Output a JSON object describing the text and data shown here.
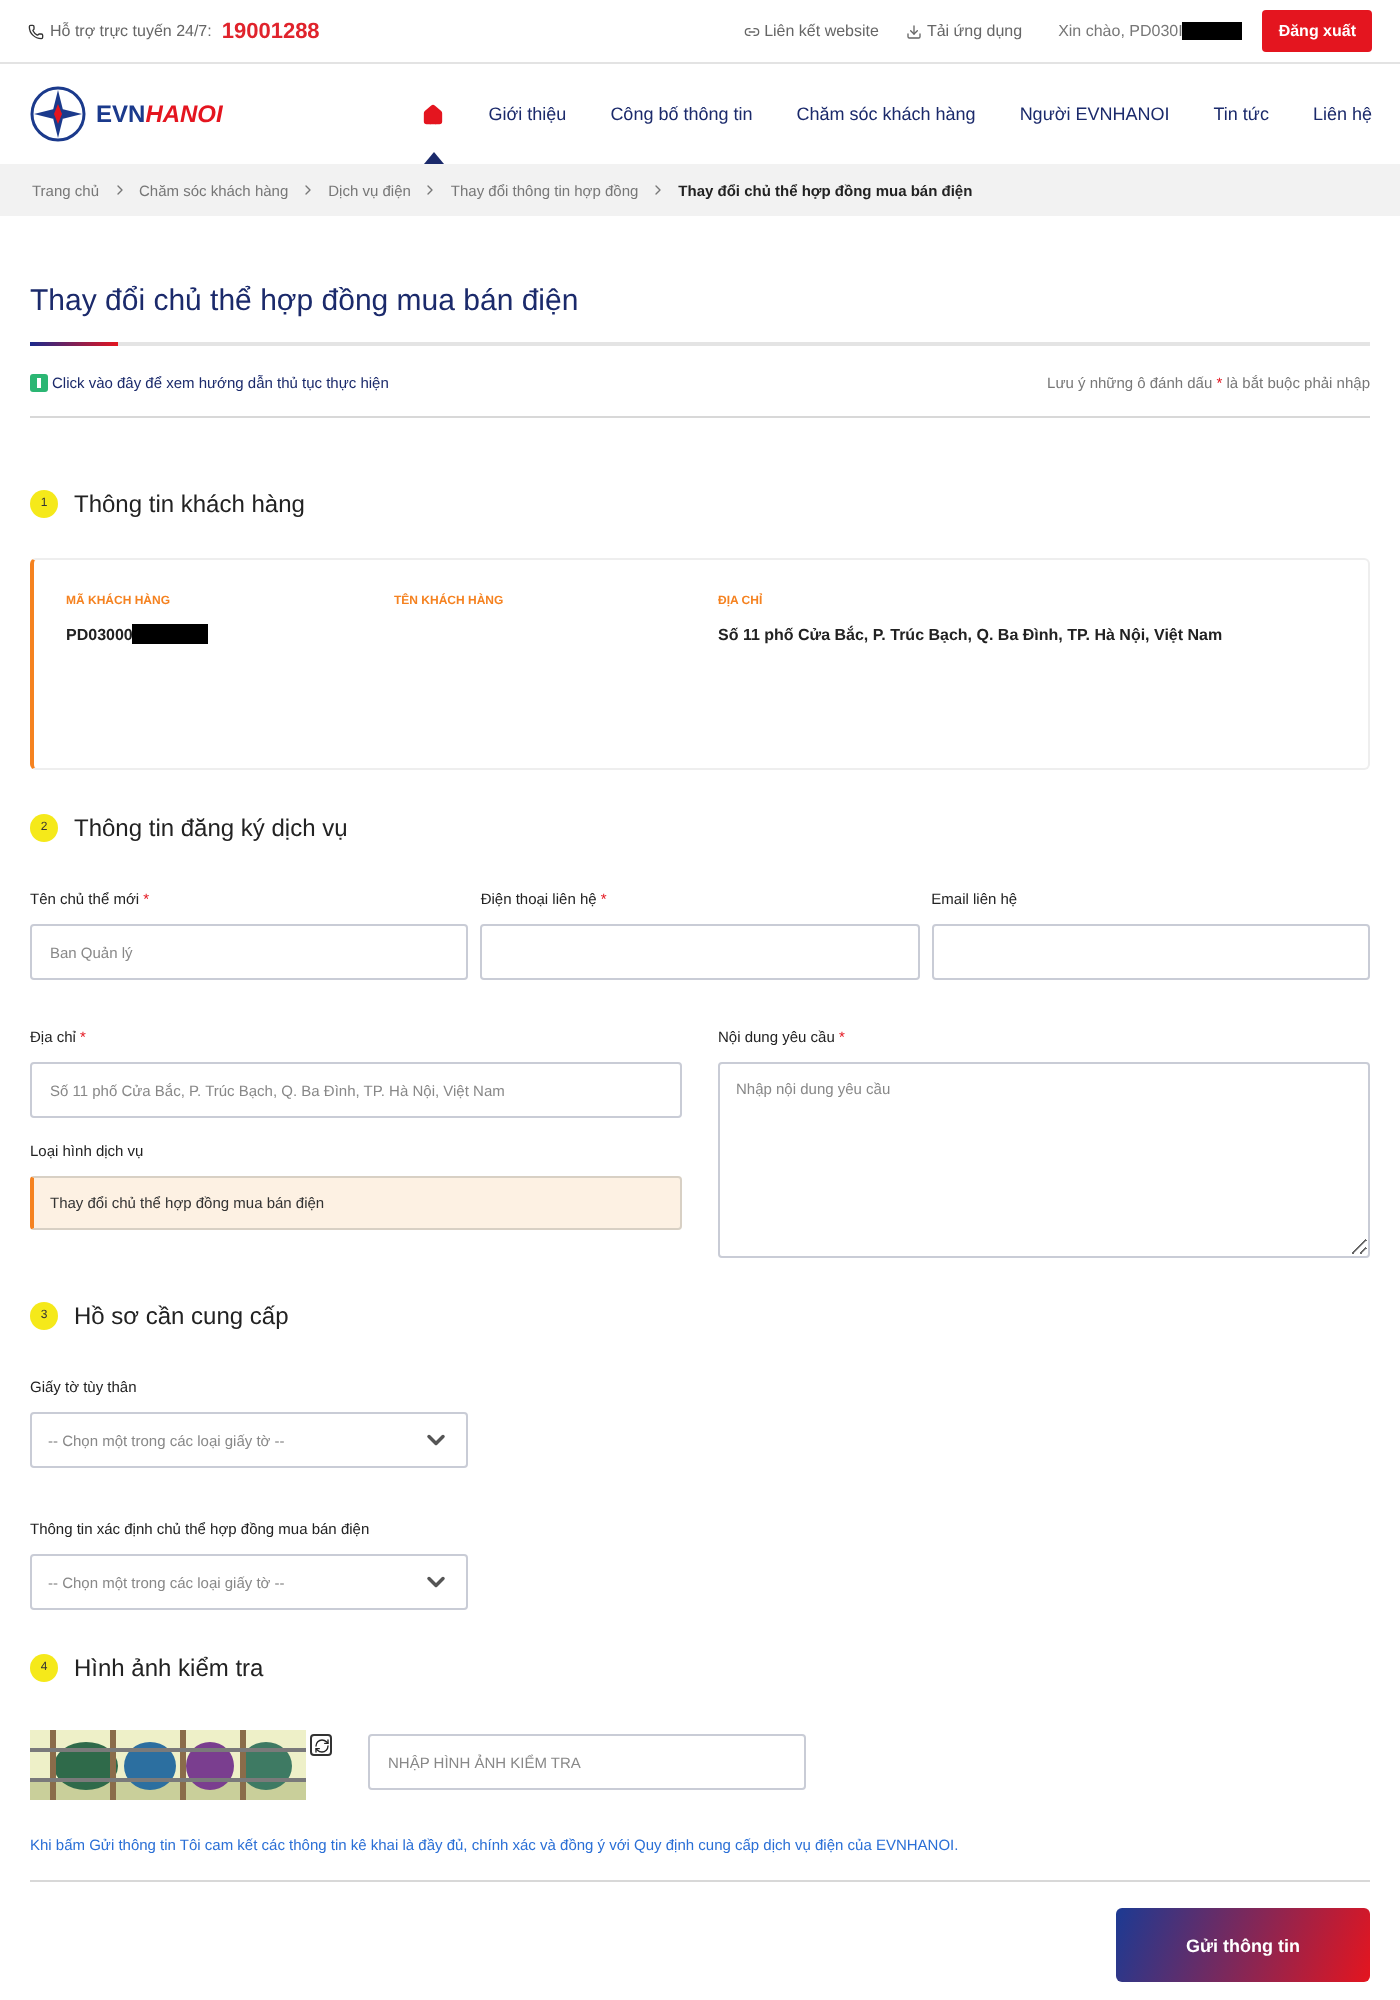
{
  "top_bar": {
    "hotline_label": "Hỗ trợ trực tuyến 24/7:",
    "hotline": "19001288",
    "links": [
      {
        "kind": "link",
        "label": "Liên kết website"
      },
      {
        "kind": "download",
        "label": "Tải ứng dụng"
      }
    ],
    "greeting": "Xin chào, PD030I",
    "logout": "Đăng xuất"
  },
  "header": {
    "logo_primary": "EVN",
    "logo_secondary": "HANOI",
    "nav": [
      {
        "kind": "home",
        "selected": true
      },
      {
        "kind": "text",
        "label": "Giới thiệu",
        "selected": false
      },
      {
        "kind": "text",
        "label": "Công bố thông tin",
        "selected": false
      },
      {
        "kind": "text",
        "label": "Chăm sóc khách hàng",
        "selected": false
      },
      {
        "kind": "text",
        "label": "Người EVNHANOI",
        "selected": false
      },
      {
        "kind": "text",
        "label": "Tin tức",
        "selected": false
      },
      {
        "kind": "text",
        "label": "Liên hệ",
        "selected": false
      }
    ]
  },
  "breadcrumb": [
    {
      "label": "Trang chủ",
      "current": false
    },
    {
      "label": "Chăm sóc khách hàng",
      "current": false
    },
    {
      "label": "Dịch vụ điện",
      "current": false
    },
    {
      "label": "Thay đổi thông tin hợp đồng",
      "current": false
    },
    {
      "label": "Thay đổi chủ thể hợp đồng mua bán điện",
      "current": true
    }
  ],
  "page_title": "Thay đổi chủ thể hợp đồng mua bán điện",
  "guide_link": "Click vào đây để xem hướng dẫn thủ tục thực hiện",
  "required_note": {
    "before": "Lưu ý những ô đánh dấu",
    "mark": "*",
    "after": "là bắt buộc phải nhập"
  },
  "sections": [
    {
      "number": "1",
      "title": "Thông tin khách hàng",
      "kind": "info",
      "columns": [
        {
          "label": "MÃ KHÁCH HÀNG",
          "value": "PD03000",
          "redacted": true
        },
        {
          "label": "TÊN KHÁCH HÀNG"
        },
        {
          "label": "ĐỊA CHỈ",
          "value": "Số 11 phố Cửa Bắc, P. Trúc Bạch, Q. Ba Đình, TP. Hà Nội, Việt Nam",
          "redacted": false
        }
      ]
    },
    {
      "number": "2",
      "title": "Thông tin đăng ký dịch vụ",
      "kind": "form"
    },
    {
      "number": "3",
      "title": "Hồ sơ cần cung cấp",
      "kind": "documents"
    },
    {
      "number": "4",
      "title": "Hình ảnh kiểm tra",
      "kind": "captcha"
    }
  ],
  "service_form": {
    "row": [
      {
        "label": "Tên chủ thể mới",
        "required_mark": "*",
        "placeholder": "Ban Quản lý"
      },
      {
        "label": "Điện thoại liên hệ",
        "required_mark": "*"
      },
      {
        "label": "Email liên hệ"
      }
    ],
    "address": {
      "label": "Địa chỉ",
      "required_mark": "*",
      "placeholder": "Số 11 phố Cửa Bắc, P. Trúc Bạch, Q. Ba Đình, TP. Hà Nội, Việt Nam"
    },
    "service_type": {
      "label": "Loại hình dịch vụ",
      "value": "Thay đổi chủ thể hợp đồng mua bán điện"
    },
    "request": {
      "label": "Nội dung yêu cầu",
      "required_mark": "*",
      "placeholder": "Nhập nội dung yêu cầu"
    }
  },
  "documents": [
    {
      "label": "Giấy tờ tùy thân",
      "placeholder": "-- Chọn một trong các loại giấy tờ --"
    },
    {
      "label": "Thông tin xác định chủ thể hợp đồng mua bán điện",
      "placeholder": "-- Chọn một trong các loại giấy tờ --"
    }
  ],
  "captcha": {
    "placeholder": "NHẬP HÌNH ẢNH KIỂM TRA"
  },
  "commitment": "Khi bấm Gửi thông tin Tôi cam kết các thông tin kê khai là đầy đủ, chính xác và đồng ý với Quy định cung cấp dịch vụ điện của EVNHANOI.",
  "submit": "Gửi thông tin"
}
